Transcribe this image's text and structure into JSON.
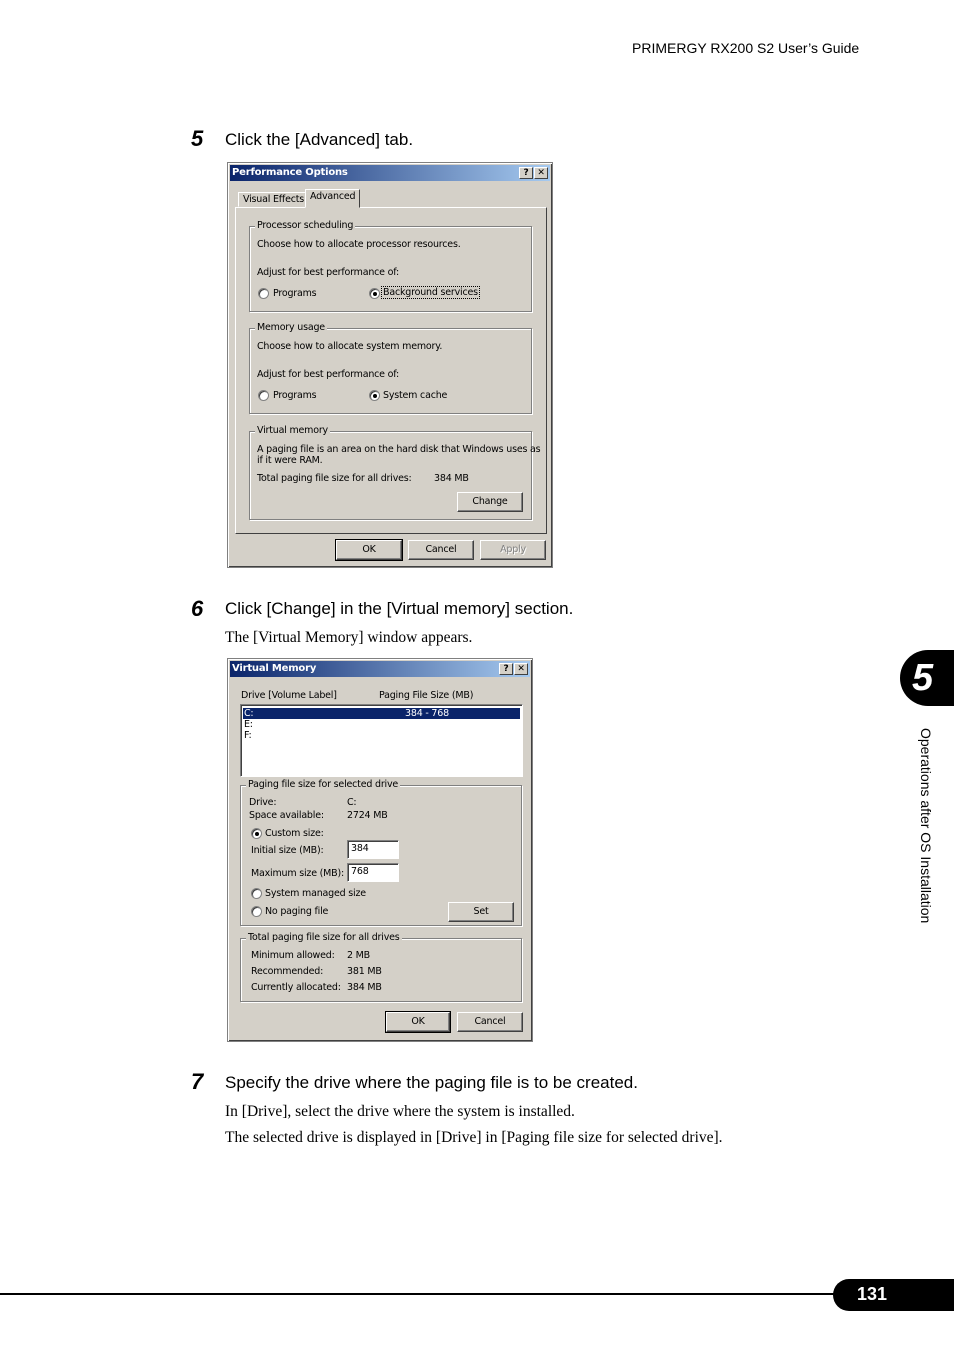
{
  "header": {
    "title": "PRIMERGY RX200 S2 User’s Guide"
  },
  "steps": [
    {
      "number": "5",
      "text": "Click the [Advanced] tab.",
      "notes": []
    },
    {
      "number": "6",
      "text": "Click [Change] in the [Virtual memory] section.",
      "notes": [
        "The [Virtual Memory] window appears."
      ]
    },
    {
      "number": "7",
      "text": "Specify the drive where the paging file is to be created.",
      "notes": [
        "In [Drive], select the drive where the system is installed.",
        "The selected drive is displayed in [Drive] in [Paging file size for selected drive]."
      ]
    }
  ],
  "performance_dialog": {
    "title": "Performance Options",
    "help_icon": "question-mark-icon",
    "close_icon": "close-x-icon",
    "tabs": [
      "Visual Effects",
      "Advanced"
    ],
    "active_tab": "Advanced",
    "processor": {
      "legend": "Processor scheduling",
      "description": "Choose how to allocate processor resources.",
      "adjust_label": "Adjust for best performance of:",
      "options": [
        "Programs",
        "Background services"
      ],
      "selected": "Background services"
    },
    "memory": {
      "legend": "Memory usage",
      "description": "Choose how to allocate system memory.",
      "adjust_label": "Adjust for best performance of:",
      "options": [
        "Programs",
        "System cache"
      ],
      "selected": "System cache"
    },
    "virtual_memory": {
      "legend": "Virtual memory",
      "description_line1": "A paging file is an area on the hard disk that Windows uses as",
      "description_line2": "if it were RAM.",
      "total_label": "Total paging file size for all drives:",
      "total_value": "384 MB",
      "change_button": "Change"
    },
    "buttons": {
      "ok": "OK",
      "cancel": "Cancel",
      "apply": "Apply"
    }
  },
  "virtual_memory_dialog": {
    "title": "Virtual Memory",
    "help_icon": "question-mark-icon",
    "close_icon": "close-x-icon",
    "list_headers": {
      "drive": "Drive  [Volume Label]",
      "size": "Paging File Size (MB)"
    },
    "drives": [
      {
        "drive": "C:",
        "size": "384 - 768",
        "selected": true
      },
      {
        "drive": "E:",
        "size": "",
        "selected": false
      },
      {
        "drive": "F:",
        "size": "",
        "selected": false
      }
    ],
    "selected_drive_group": {
      "legend": "Paging file size for selected drive",
      "drive_label": "Drive:",
      "drive_value": "C:",
      "space_label": "Space available:",
      "space_value": "2724 MB",
      "custom_size_label": "Custom size:",
      "initial_label": "Initial size (MB):",
      "initial_value": "384",
      "maximum_label": "Maximum size (MB):",
      "maximum_value": "768",
      "system_managed_label": "System managed size",
      "no_paging_label": "No paging file",
      "selected_option": "Custom size",
      "set_button": "Set"
    },
    "total_group": {
      "legend": "Total paging file size for all drives",
      "min_label": "Minimum allowed:",
      "min_value": "2 MB",
      "recommended_label": "Recommended:",
      "recommended_value": "381 MB",
      "allocated_label": "Currently allocated:",
      "allocated_value": "384 MB"
    },
    "buttons": {
      "ok": "OK",
      "cancel": "Cancel"
    }
  },
  "sidebar": {
    "chapter_number": "5",
    "chapter_title": "Operations after OS Installation"
  },
  "footer": {
    "page_number": "131"
  }
}
